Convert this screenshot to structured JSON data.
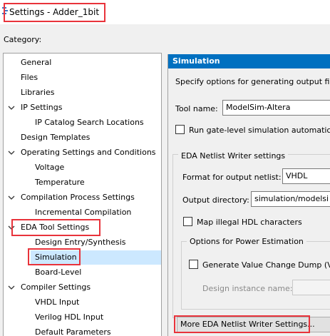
{
  "window": {
    "title": "Settings - Adder_1bit"
  },
  "category_label": "Category:",
  "tree": {
    "items": [
      {
        "label": "General"
      },
      {
        "label": "Files"
      },
      {
        "label": "Libraries"
      },
      {
        "label": "IP Settings"
      },
      {
        "label": "IP Catalog Search Locations"
      },
      {
        "label": "Design Templates"
      },
      {
        "label": "Operating Settings and Conditions"
      },
      {
        "label": "Voltage"
      },
      {
        "label": "Temperature"
      },
      {
        "label": "Compilation Process Settings"
      },
      {
        "label": "Incremental Compilation"
      },
      {
        "label": "EDA Tool Settings"
      },
      {
        "label": "Design Entry/Synthesis"
      },
      {
        "label": "Simulation"
      },
      {
        "label": "Board-Level"
      },
      {
        "label": "Compiler Settings"
      },
      {
        "label": "VHDL Input"
      },
      {
        "label": "Verilog HDL Input"
      },
      {
        "label": "Default Parameters"
      }
    ]
  },
  "panel": {
    "header": "Simulation",
    "description": "Specify options for generating output file",
    "tool_name_label": "Tool name:",
    "tool_name_value": "ModelSim-Altera",
    "run_gate_level_label": "Run gate-level simulation automatica",
    "netlist_group_title": "EDA Netlist Writer settings",
    "format_label": "Format for output netlist:",
    "format_value": "VHDL",
    "output_dir_label": "Output directory:",
    "output_dir_value": "simulation/modelsi",
    "map_illegal_label": "Map illegal HDL characters",
    "power_group_title": "Options for Power Estimation",
    "gen_vcd_label": "Generate Value Change Dump (VC",
    "instance_name_label": "Design instance name:",
    "more_button": "More EDA Netlist Writer Settings..."
  },
  "colors": {
    "header_blue": "#0070c0",
    "selection": "#cce8ff",
    "highlight_red": "#e8333b"
  }
}
